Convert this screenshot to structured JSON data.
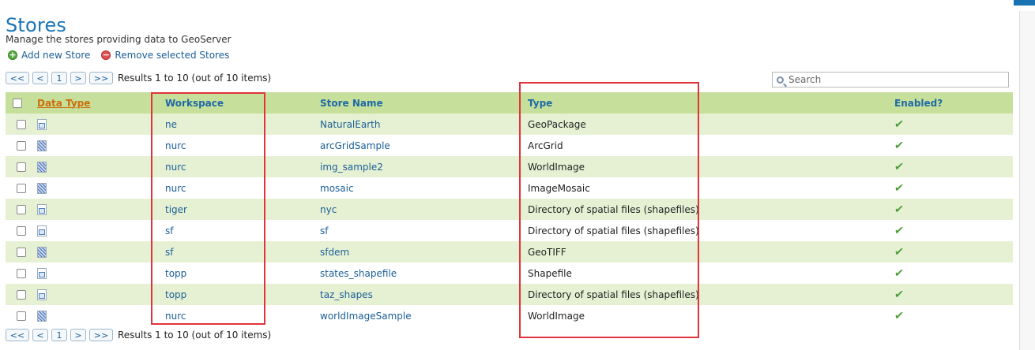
{
  "page": {
    "title": "Stores",
    "description": "Manage the stores providing data to GeoServer",
    "actions": {
      "add": "Add new Store",
      "remove": "Remove selected Stores"
    }
  },
  "pager": {
    "first": "<<",
    "prev": "<",
    "page": "1",
    "next": ">",
    "last": ">>",
    "info": "Results 1 to 10 (out of 10 items)"
  },
  "search": {
    "placeholder": "Search"
  },
  "table": {
    "headers": {
      "data_type": "Data Type",
      "workspace": "Workspace",
      "store_name": "Store Name",
      "type": "Type",
      "enabled": "Enabled?"
    },
    "rows": [
      {
        "kind": "vector",
        "workspace": "ne",
        "store": "NaturalEarth",
        "type": "GeoPackage",
        "enabled": "✔"
      },
      {
        "kind": "raster",
        "workspace": "nurc",
        "store": "arcGridSample",
        "type": "ArcGrid",
        "enabled": "✔"
      },
      {
        "kind": "raster",
        "workspace": "nurc",
        "store": "img_sample2",
        "type": "WorldImage",
        "enabled": "✔"
      },
      {
        "kind": "raster",
        "workspace": "nurc",
        "store": "mosaic",
        "type": "ImageMosaic",
        "enabled": "✔"
      },
      {
        "kind": "vector",
        "workspace": "tiger",
        "store": "nyc",
        "type": "Directory of spatial files (shapefiles)",
        "enabled": "✔"
      },
      {
        "kind": "vector",
        "workspace": "sf",
        "store": "sf",
        "type": "Directory of spatial files (shapefiles)",
        "enabled": "✔"
      },
      {
        "kind": "raster",
        "workspace": "sf",
        "store": "sfdem",
        "type": "GeoTIFF",
        "enabled": "✔"
      },
      {
        "kind": "vector",
        "workspace": "topp",
        "store": "states_shapefile",
        "type": "Shapefile",
        "enabled": "✔"
      },
      {
        "kind": "vector",
        "workspace": "topp",
        "store": "taz_shapes",
        "type": "Directory of spatial files (shapefiles)",
        "enabled": "✔"
      },
      {
        "kind": "raster",
        "workspace": "nurc",
        "store": "worldImageSample",
        "type": "WorldImage",
        "enabled": "✔"
      }
    ]
  },
  "colors": {
    "accent": "#1a74b8",
    "header_bg": "#c6df9a",
    "row_alt": "#e6f1d4",
    "highlight": "#e0333b"
  }
}
